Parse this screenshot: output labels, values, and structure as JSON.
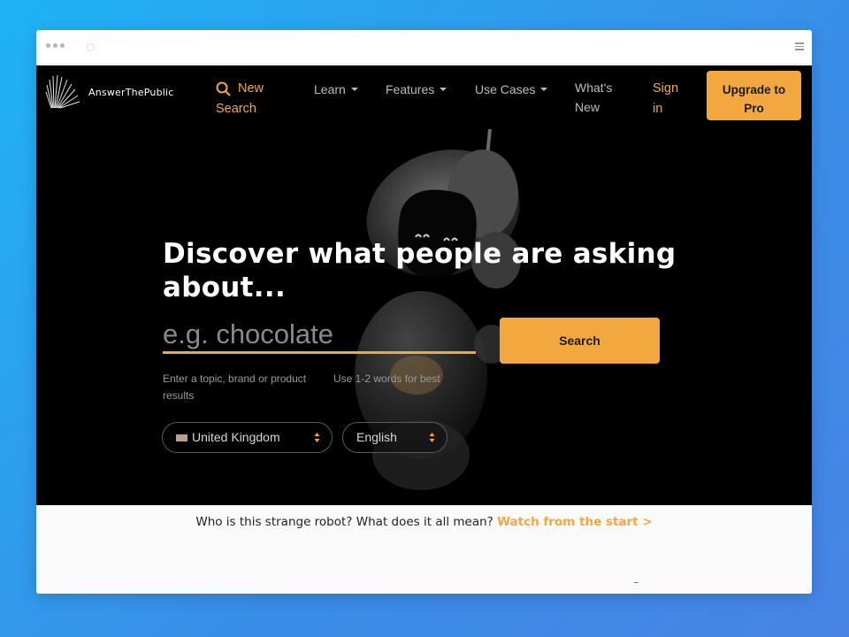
{
  "colors": {
    "accent": "#f3a73f",
    "site_background": "#000000",
    "page_gradient_start": "#1fb3f5",
    "page_gradient_end": "#4784e6"
  },
  "browser": {
    "window_dots_icon": "traffic-lights-icon",
    "loading_icon": "spinner-icon",
    "menu_icon": "hamburger-icon"
  },
  "nav": {
    "logo_text": "AnswerThePublic",
    "new_search": {
      "line1": "New",
      "line2": "Search",
      "icon": "search-icon"
    },
    "links": [
      {
        "label": "Learn",
        "dropdown": true
      },
      {
        "label": "Features",
        "dropdown": true
      },
      {
        "label": "Use Cases",
        "dropdown": true
      }
    ],
    "whats_new": {
      "line1": "What's",
      "line2": "New"
    },
    "sign_in": {
      "line1": "Sign",
      "line2": "in"
    },
    "upgrade": {
      "line1": "Upgrade to",
      "line2": "Pro"
    }
  },
  "hero": {
    "title_line1": "Discover what people are asking",
    "title_line2": "about...",
    "search_placeholder": "e.g. chocolate",
    "search_value": "",
    "search_button": "Search",
    "hint_left_line1": "Enter a topic, brand or product",
    "hint_left_line2": "results",
    "hint_right": "Use 1-2 words for best",
    "country_select": {
      "value": "United Kingdom",
      "icon": "uk-flag-icon"
    },
    "language_select": {
      "value": "English"
    }
  },
  "footer": {
    "question": "Who is this strange robot? What does it all mean?",
    "watch_link": "Watch from the start >"
  }
}
